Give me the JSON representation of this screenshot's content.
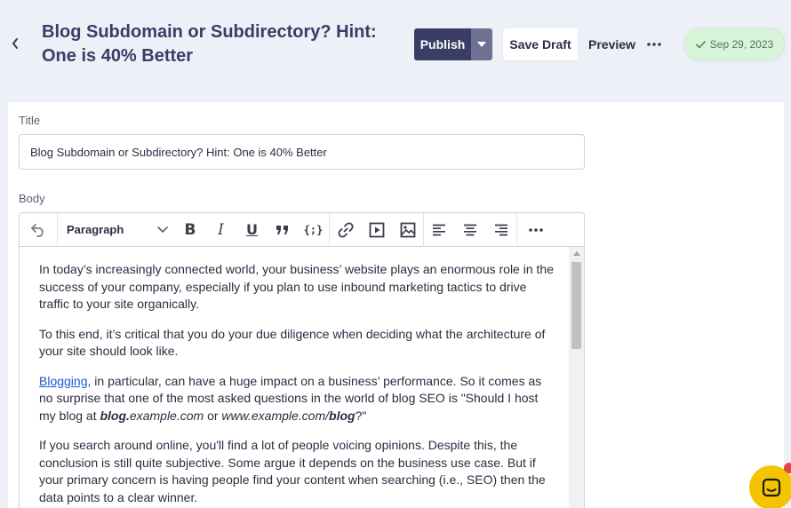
{
  "header": {
    "title": "Blog Subdomain or Subdirectory? Hint: One is 40% Better",
    "publish_label": "Publish",
    "save_draft_label": "Save Draft",
    "preview_label": "Preview",
    "date_badge": "Sep 29, 2023"
  },
  "form": {
    "title_label": "Title",
    "title_value": "Blog Subdomain or Subdirectory? Hint: One is 40% Better",
    "body_label": "Body"
  },
  "toolbar": {
    "block_style": "Paragraph"
  },
  "body": {
    "p1": "In today’s increasingly connected world, your business’ website plays an enormous role in the success of your company, especially if you plan to use inbound marketing tactics to drive traffic to your site organically.",
    "p2": "To this end, it’s critical that you do your due diligence when deciding what the architecture of your site should look like.",
    "p3_link": "Blogging",
    "p3_text": ", in particular, can have a huge impact on a business’ performance. So it comes as no surprise that one of the most asked questions in the world of blog SEO is \"Should I host my blog at ",
    "p3_bold1": "blog.",
    "p3_italic1": "example.com",
    "p3_or": " or ",
    "p3_italic2": "www.example.com/",
    "p3_bold2": "blog",
    "p3_end": "?\"",
    "p4": "If you search around online, you'll find a lot of people voicing opinions. Despite this, the conclusion is still quite subjective. Some argue it depends on the business use case. But if your primary concern is having people find your content when searching (i.e., SEO) then the data points to a clear winner."
  },
  "colors": {
    "brand_dark": "#3a3d66",
    "badge_bg": "#d7f5d8",
    "chat_yellow": "#f5c400",
    "link_blue": "#1a57d1"
  }
}
